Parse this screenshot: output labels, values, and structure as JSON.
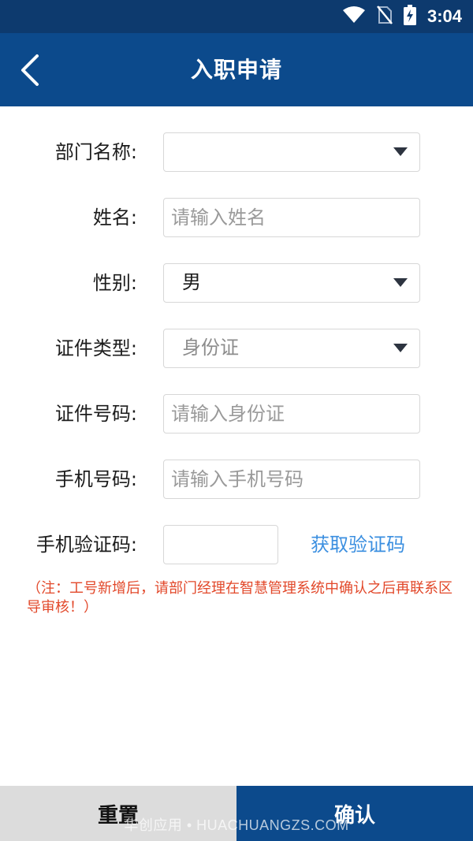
{
  "status_bar": {
    "time": "3:04"
  },
  "app_bar": {
    "title": "入职申请"
  },
  "form": {
    "department": {
      "label": "部门名称:",
      "value": ""
    },
    "name": {
      "label": "姓名:",
      "placeholder": "请输入姓名"
    },
    "gender": {
      "label": "性别:",
      "value": "男"
    },
    "id_type": {
      "label": "证件类型:",
      "value": "身份证"
    },
    "id_number": {
      "label": "证件号码:",
      "placeholder": "请输入身份证"
    },
    "phone": {
      "label": "手机号码:",
      "placeholder": "请输入手机号码"
    },
    "sms_code": {
      "label": "手机验证码:",
      "value": "",
      "get_code_label": "获取验证码"
    }
  },
  "note": "（注：工号新增后，请部门经理在智慧管理系统中确认之后再联系区导审核！）",
  "footer": {
    "reset_label": "重置",
    "confirm_label": "确认"
  },
  "watermark": "华创应用 • HUACHUANGZS.COM",
  "colors": {
    "primary": "#0c4a8c",
    "status_bar": "#0d3a6e",
    "link": "#3b8fe0",
    "note": "#e2482a"
  }
}
